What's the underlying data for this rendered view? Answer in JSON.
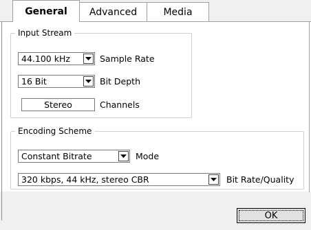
{
  "tabs": [
    {
      "label": "General",
      "active": true
    },
    {
      "label": "Advanced",
      "active": false
    },
    {
      "label": "Media",
      "active": false
    }
  ],
  "input_stream": {
    "title": "Input Stream",
    "sample_rate": {
      "value": "44.100 kHz",
      "label": "Sample Rate"
    },
    "bit_depth": {
      "value": "16 Bit",
      "label": "Bit Depth"
    },
    "channels": {
      "value": "Stereo",
      "label": "Channels"
    }
  },
  "encoding_scheme": {
    "title": "Encoding Scheme",
    "mode": {
      "value": "Constant Bitrate",
      "label": "Mode"
    },
    "bitrate": {
      "value": "320 kbps, 44 kHz, stereo CBR",
      "label": "Bit Rate/Quality"
    }
  },
  "buttons": {
    "ok": "OK"
  },
  "icons": {
    "dropdown": "chevron-down-icon"
  }
}
